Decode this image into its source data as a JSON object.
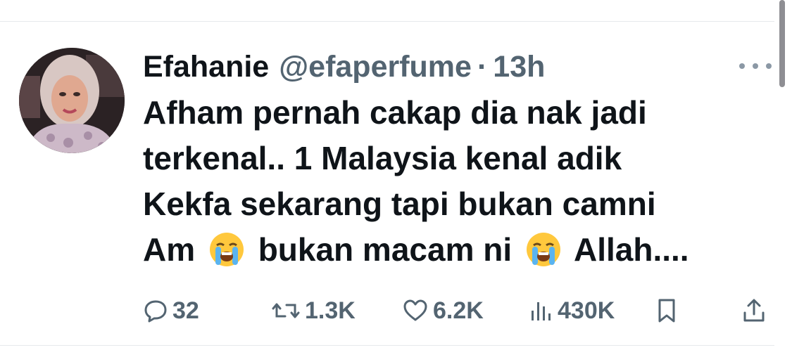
{
  "tweet": {
    "display_name": "Efahanie",
    "handle": "@efaperfume",
    "separator": "·",
    "time": "13h",
    "text_lines": [
      "Afham pernah cakap dia nak jadi",
      "terkenal.. 1 Malaysia kenal adik",
      "Kekfa sekarang tapi bukan camni"
    ],
    "last_line": {
      "part1": "Am",
      "part2": "bukan macam ni",
      "part3": "Allah...."
    },
    "emoji_name": "loudly-crying-face"
  },
  "actions": {
    "replies": "32",
    "reposts": "1.3K",
    "likes": "6.2K",
    "views": "430K"
  },
  "colors": {
    "text": "#0f1419",
    "secondary": "#536471",
    "divider": "#e6e9ec"
  },
  "icons": [
    "more-icon",
    "reply-icon",
    "repost-icon",
    "like-icon",
    "views-icon",
    "bookmark-icon",
    "share-icon"
  ]
}
